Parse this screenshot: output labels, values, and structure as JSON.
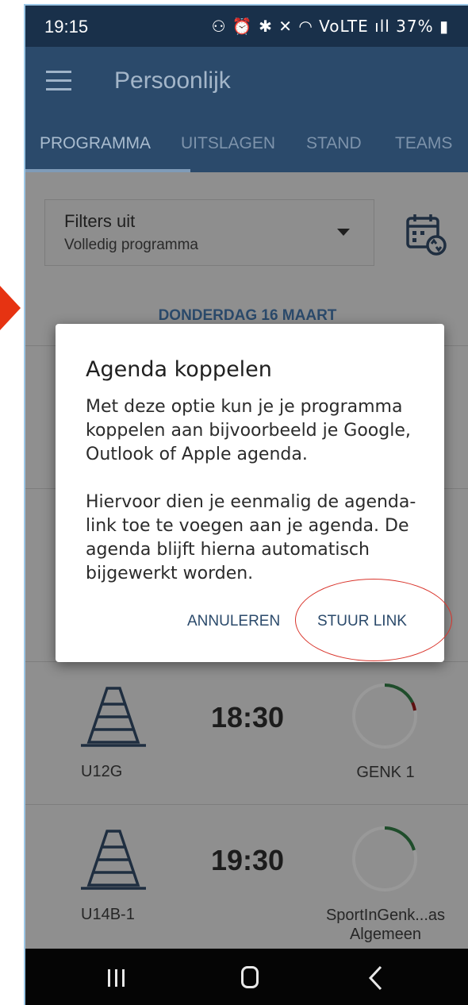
{
  "status_bar": {
    "time": "19:15",
    "icons_text": "⚇ ⏰ ✱ ✕ ◠ VoLTE ıll 37% ▮",
    "battery": "37%"
  },
  "app_bar": {
    "title": "Persoonlijk",
    "menu_icon": "hamburger-menu-icon"
  },
  "tabs": [
    {
      "label": "PROGRAMMA",
      "active": true
    },
    {
      "label": "UITSLAGEN",
      "active": false
    },
    {
      "label": "STAND",
      "active": false
    },
    {
      "label": "TEAMS",
      "active": false
    }
  ],
  "filter": {
    "title": "Filters uit",
    "subtitle": "Volledig programma"
  },
  "calendar_sync_icon": "calendar-sync-icon",
  "date_header": "DONDERDAG 16 MAART",
  "matches": [
    {
      "team": "U12G",
      "time": "18:30",
      "opponent": "GENK 1"
    },
    {
      "team": "U14B-1",
      "time": "19:30",
      "opponent": "SportInGenk...as Algemeen"
    }
  ],
  "dialog": {
    "title": "Agenda koppelen",
    "paragraph1": "Met deze optie kun je je programma koppelen aan bijvoorbeeld je Google, Outlook of Apple agenda.",
    "paragraph2": "Hiervoor dien je eenmalig de agenda-link toe te voegen aan je agenda. De agenda blijft hierna automatisch bijgewerkt worden.",
    "cancel_label": "ANNULEREN",
    "confirm_label": "STUUR LINK"
  },
  "colors": {
    "app_bar": "#2b4a6b",
    "accent_text": "#2b4a6b",
    "annotation_red": "#e63312",
    "scrim_content": "#8f8f8f"
  }
}
